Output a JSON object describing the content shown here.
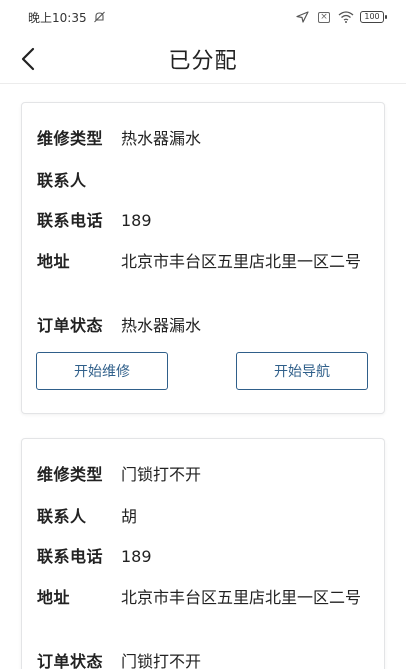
{
  "status_bar": {
    "time": "晚上10:35",
    "battery": "100"
  },
  "header": {
    "title": "已分配"
  },
  "labels": {
    "repair_type": "维修类型",
    "contact": "联系人",
    "phone": "联系电话",
    "address": "地址",
    "order_status": "订单状态"
  },
  "orders": [
    {
      "repair_type": "热水器漏水",
      "contact": "",
      "phone": "189",
      "address": "北京市丰台区五里店北里一区二号",
      "order_status": "热水器漏水",
      "buttons": {
        "start_repair": "开始维修",
        "start_navigation": "开始导航"
      }
    },
    {
      "repair_type": "门锁打不开",
      "contact": "胡",
      "phone": "189",
      "address": "北京市丰台区五里店北里一区二号",
      "order_status": "门锁打不开"
    }
  ],
  "colors": {
    "accent": "#2f5f8a",
    "background": "#f4f5f7",
    "card_border": "#e3e4e6"
  }
}
